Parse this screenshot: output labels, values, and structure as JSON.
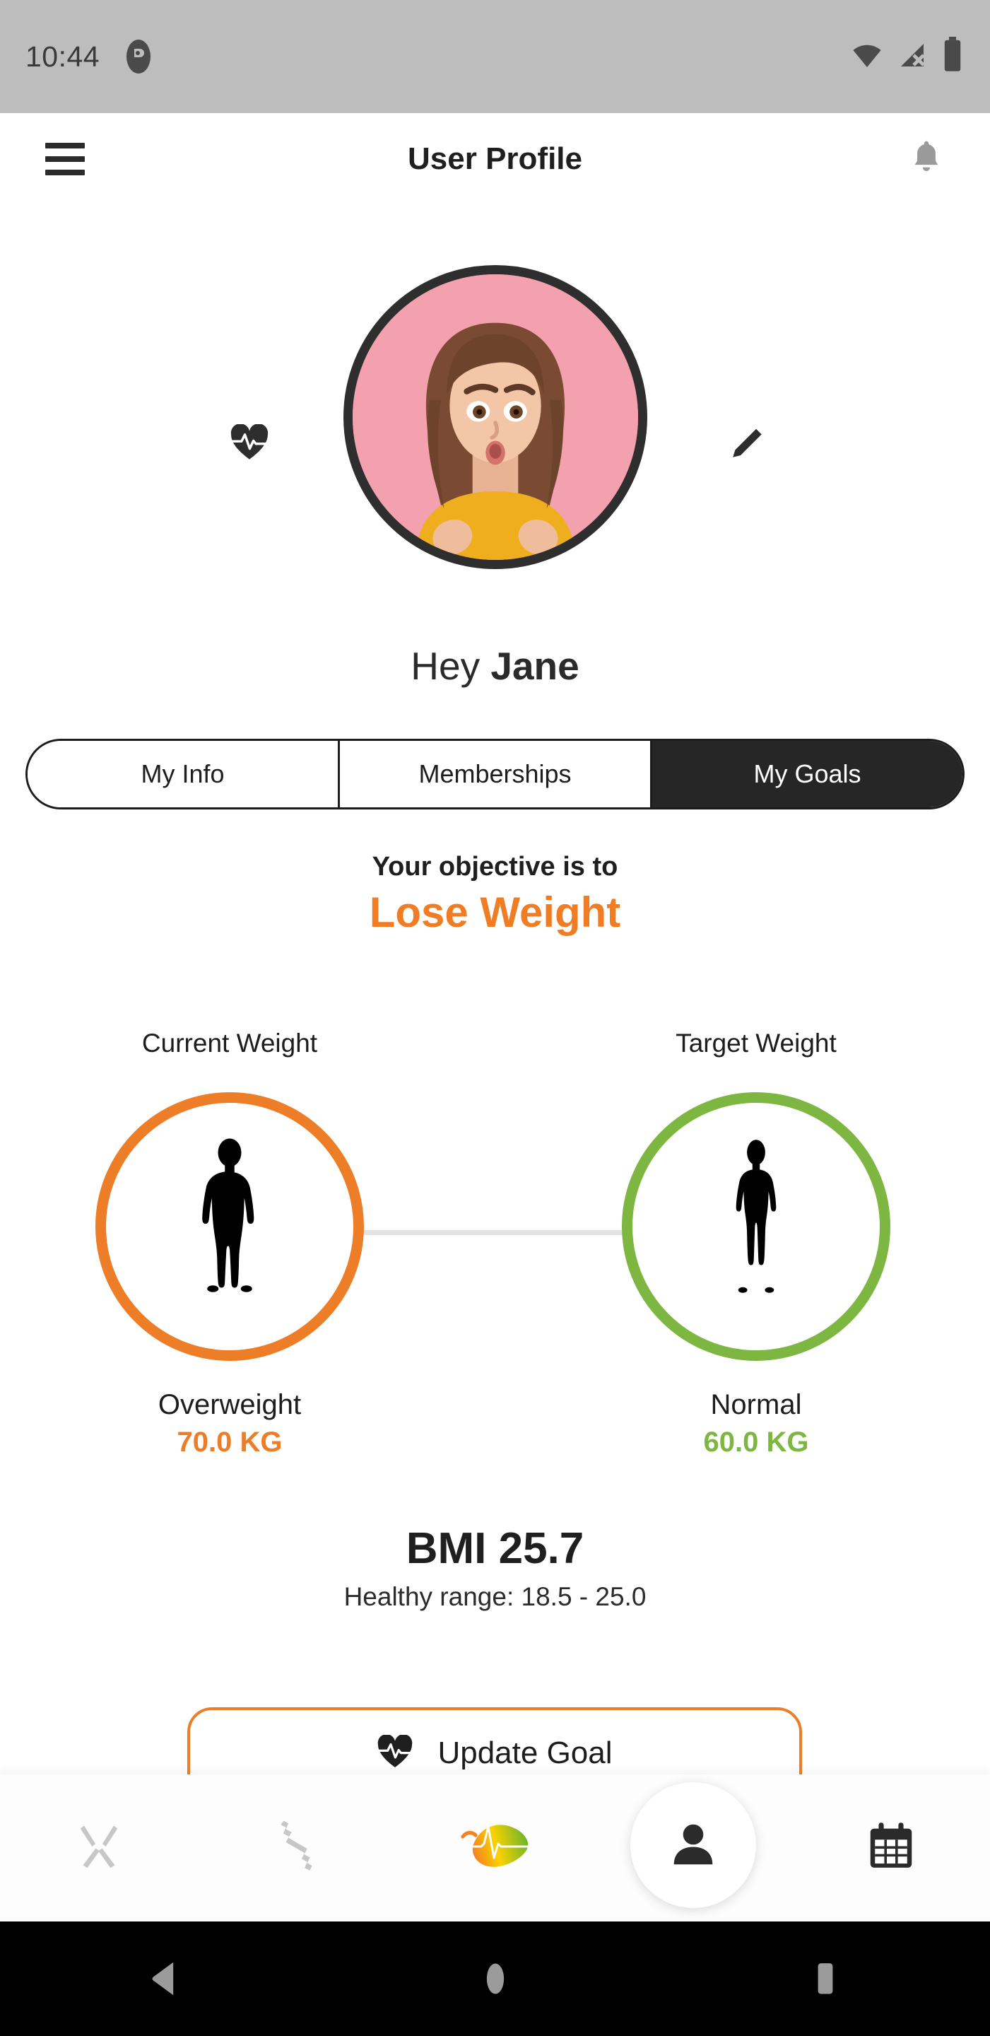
{
  "status_bar": {
    "time": "10:44",
    "app_icon": "app-badge-icon",
    "icons": [
      "wifi-icon",
      "cellular-signal-off-icon",
      "battery-full-icon"
    ]
  },
  "header": {
    "menu_icon": "hamburger-menu-icon",
    "title": "User Profile",
    "notification_icon": "bell-icon"
  },
  "profile": {
    "avatar_alt": "user-avatar-photo",
    "left_icon": "heart-pulse-icon",
    "right_icon": "edit-pencil-icon",
    "greeting_prefix": "Hey ",
    "name": "Jane"
  },
  "tabs": [
    {
      "label": "My Info",
      "active": false
    },
    {
      "label": "Memberships",
      "active": false
    },
    {
      "label": "My Goals",
      "active": true
    }
  ],
  "objective": {
    "label": "Your objective is to",
    "value": "Lose Weight",
    "accent_color": "#f07d24"
  },
  "weights": {
    "current": {
      "title": "Current Weight",
      "status": "Overweight",
      "value": "70.0 KG",
      "color": "#ee7d28",
      "body_icon": "heavy-body-silhouette-icon"
    },
    "target": {
      "title": "Target Weight",
      "status": "Normal",
      "value": "60.0 KG",
      "color": "#7db742",
      "body_icon": "slim-body-silhouette-icon"
    }
  },
  "bmi": {
    "main": "BMI 25.7",
    "sub": "Healthy range: 18.5 - 25.0"
  },
  "update_goal": {
    "icon": "heart-pulse-icon",
    "label": "Update Goal",
    "border_color": "#ee7d28"
  },
  "bottom_nav": [
    {
      "icon": "cutlery-icon",
      "active": false
    },
    {
      "icon": "dumbbell-icon",
      "active": false
    },
    {
      "icon": "leaf-pulse-logo-icon",
      "active": false
    },
    {
      "icon": "person-icon",
      "active": true
    },
    {
      "icon": "calendar-icon",
      "active": false
    }
  ],
  "android_nav": [
    {
      "icon": "back-triangle-icon"
    },
    {
      "icon": "home-circle-icon"
    },
    {
      "icon": "recents-square-icon"
    }
  ]
}
